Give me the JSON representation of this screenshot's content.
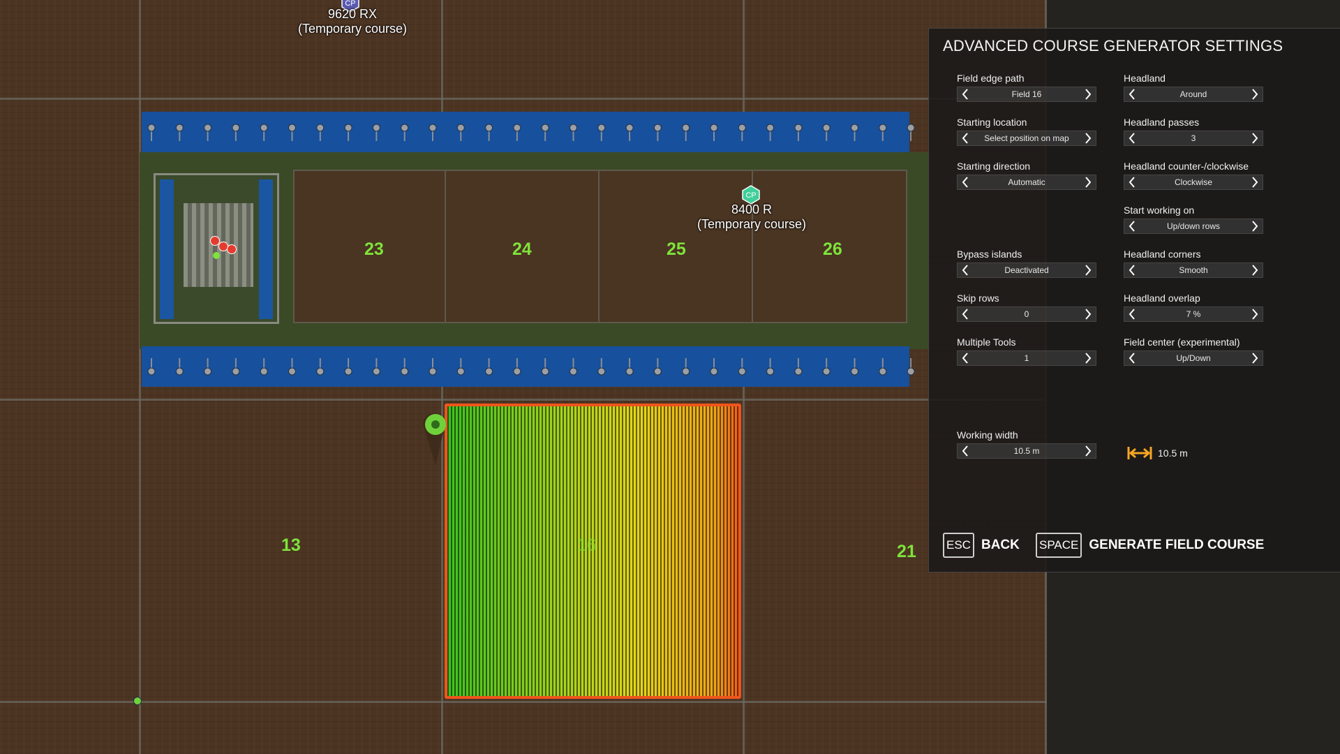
{
  "map": {
    "field_numbers": [
      "23",
      "24",
      "25",
      "26",
      "13",
      "16",
      "21"
    ],
    "vehicles": [
      {
        "name": "9620 RX",
        "status": "(Temporary course)",
        "badge": "CP"
      },
      {
        "name": "8400 R",
        "status": "(Temporary course)",
        "badge": "CP"
      }
    ]
  },
  "panel": {
    "title": "ADVANCED COURSE GENERATOR SETTINGS",
    "left_settings": [
      {
        "label": "Field edge path",
        "value": "Field 16"
      },
      {
        "label": "Starting location",
        "value": "Select position on map"
      },
      {
        "label": "Starting direction",
        "value": "Automatic"
      },
      {
        "label": "Bypass islands",
        "value": "Deactivated"
      },
      {
        "label": "Skip rows",
        "value": "0"
      },
      {
        "label": "Multiple Tools",
        "value": "1"
      }
    ],
    "right_settings": [
      {
        "label": "Headland",
        "value": "Around"
      },
      {
        "label": "Headland passes",
        "value": "3"
      },
      {
        "label": "Headland counter-/clockwise",
        "value": "Clockwise"
      },
      {
        "label": "Start working on",
        "value": "Up/down rows"
      },
      {
        "label": "Headland corners",
        "value": "Smooth"
      },
      {
        "label": "Headland overlap",
        "value": "7 %"
      },
      {
        "label": "Field center (experimental)",
        "value": "Up/Down"
      }
    ],
    "working_width": {
      "label": "Working width",
      "value": "10.5 m",
      "display": "10.5 m"
    },
    "actions": {
      "back_key": "ESC",
      "back_label": "BACK",
      "generate_key": "SPACE",
      "generate_label": "GENERATE FIELD COURSE"
    }
  },
  "colors": {
    "field_number": "#7ee33b",
    "course_border": "#f0551c",
    "water": "#17509c",
    "accent_orange": "#f5a623"
  }
}
